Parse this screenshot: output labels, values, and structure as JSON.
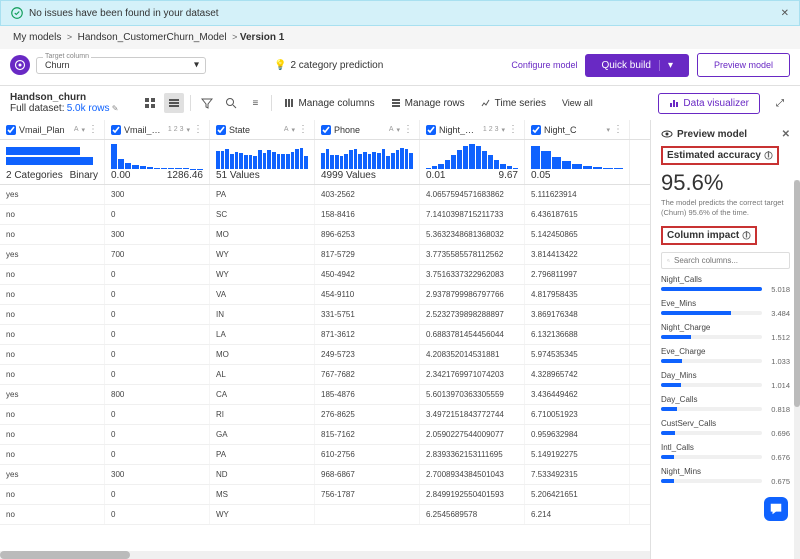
{
  "banner": {
    "text": "No issues have been found in your dataset"
  },
  "breadcrumb": {
    "items": [
      "My models",
      "Handson_CustomerChurn_Model"
    ],
    "current": "Version 1"
  },
  "target": {
    "label": "Target column",
    "value": "Churn"
  },
  "prediction": {
    "text": "2 category prediction"
  },
  "toolbar": {
    "configure": "Configure model",
    "quick_build": "Quick build",
    "preview": "Preview model"
  },
  "dataset": {
    "name": "Handson_churn",
    "meta_label": "Full dataset:",
    "rows": "5.0k rows"
  },
  "subheader": {
    "manage_cols": "Manage columns",
    "manage_rows": "Manage rows",
    "time_series": "Time series",
    "view_all": "View all",
    "data_viz": "Data visualizer"
  },
  "columns": [
    {
      "name": "Vmail_Plan",
      "type": "A",
      "meta_l": "2 Categories",
      "meta_r": "Binary",
      "chart": "bars2"
    },
    {
      "name": "Vmail_Mess...",
      "type": "1 2 3",
      "meta_l": "0.00",
      "meta_r": "1286.46",
      "chart": "hist_left"
    },
    {
      "name": "State",
      "type": "A",
      "meta_l": "51 Values",
      "meta_r": "",
      "chart": "hist_flat"
    },
    {
      "name": "Phone",
      "type": "A",
      "meta_l": "4999 Values",
      "meta_r": "",
      "chart": "hist_flat"
    },
    {
      "name": "Night_Mins",
      "type": "1 2 3",
      "meta_l": "0.01",
      "meta_r": "9.67",
      "chart": "hist_norm"
    },
    {
      "name": "Night_C",
      "type": "",
      "meta_l": "0.05",
      "meta_r": "",
      "chart": "hist_left2"
    }
  ],
  "rows": [
    {
      "c": [
        "yes",
        "300",
        "PA",
        "403-2562",
        "4.0657594571683862",
        "5.111623914"
      ]
    },
    {
      "c": [
        "no",
        "0",
        "SC",
        "158-8416",
        "7.1410398715211733",
        "6.436187615"
      ]
    },
    {
      "c": [
        "no",
        "300",
        "MO",
        "896-6253",
        "5.3632348681368032",
        "5.142450865"
      ]
    },
    {
      "c": [
        "yes",
        "700",
        "WY",
        "817-5729",
        "3.7735585578112562",
        "3.814413422"
      ]
    },
    {
      "c": [
        "no",
        "0",
        "WY",
        "450-4942",
        "3.7516337322962083",
        "2.796811997"
      ]
    },
    {
      "c": [
        "no",
        "0",
        "VA",
        "454-9110",
        "2.9378799986797766",
        "4.817958435"
      ]
    },
    {
      "c": [
        "no",
        "0",
        "IN",
        "331-5751",
        "2.5232739898288897",
        "3.869176348"
      ]
    },
    {
      "c": [
        "no",
        "0",
        "LA",
        "871-3612",
        "0.6883781454456044",
        "6.132136688"
      ]
    },
    {
      "c": [
        "no",
        "0",
        "MO",
        "249-5723",
        "4.208352014531881",
        "5.974535345"
      ]
    },
    {
      "c": [
        "no",
        "0",
        "AL",
        "767-7682",
        "2.3421769971074203",
        "4.328965742"
      ]
    },
    {
      "c": [
        "yes",
        "800",
        "CA",
        "185-4876",
        "5.6013970363305559",
        "3.436449462"
      ]
    },
    {
      "c": [
        "no",
        "0",
        "RI",
        "276-8625",
        "3.4972151843772744",
        "6.710051923"
      ]
    },
    {
      "c": [
        "no",
        "0",
        "GA",
        "815-7162",
        "2.0590227544009077",
        "0.959632984"
      ]
    },
    {
      "c": [
        "no",
        "0",
        "PA",
        "610-2756",
        "2.8393362153111695",
        "5.149192275"
      ]
    },
    {
      "c": [
        "yes",
        "300",
        "ND",
        "968-6867",
        "2.7008934384501043",
        "7.533492315"
      ]
    },
    {
      "c": [
        "no",
        "0",
        "MS",
        "756-1787",
        "2.8499192550401593",
        "5.206421651"
      ]
    },
    {
      "c": [
        "no",
        "0",
        "WY",
        "",
        "6.2545689578",
        "6.214"
      ]
    }
  ],
  "preview": {
    "title": "Preview model",
    "accuracy_label": "Estimated accuracy",
    "accuracy_value": "95.6%",
    "accuracy_desc": "The model predicts the correct target (Churn) 95.6% of the time.",
    "impact_label": "Column impact",
    "search_placeholder": "Search columns...",
    "impacts": [
      {
        "name": "Night_Calls",
        "value": "5.018",
        "pct": 100
      },
      {
        "name": "Eve_Mins",
        "value": "3.484",
        "pct": 69
      },
      {
        "name": "Night_Charge",
        "value": "1.512",
        "pct": 30
      },
      {
        "name": "Eve_Charge",
        "value": "1.033",
        "pct": 21
      },
      {
        "name": "Day_Mins",
        "value": "1.014",
        "pct": 20
      },
      {
        "name": "Day_Calls",
        "value": "0.818",
        "pct": 16
      },
      {
        "name": "CustServ_Calls",
        "value": "0.696",
        "pct": 14
      },
      {
        "name": "Intl_Calls",
        "value": "0.676",
        "pct": 13
      },
      {
        "name": "Night_Mins",
        "value": "0.675",
        "pct": 13
      }
    ]
  },
  "chart_data": {
    "type": "table",
    "column_impact": [
      {
        "x": "Night_Calls",
        "y": 5.018
      },
      {
        "x": "Eve_Mins",
        "y": 3.484
      },
      {
        "x": "Night_Charge",
        "y": 1.512
      },
      {
        "x": "Eve_Charge",
        "y": 1.033
      },
      {
        "x": "Day_Mins",
        "y": 1.014
      },
      {
        "x": "Day_Calls",
        "y": 0.818
      },
      {
        "x": "CustServ_Calls",
        "y": 0.696
      },
      {
        "x": "Intl_Calls",
        "y": 0.676
      },
      {
        "x": "Night_Mins",
        "y": 0.675
      }
    ]
  }
}
